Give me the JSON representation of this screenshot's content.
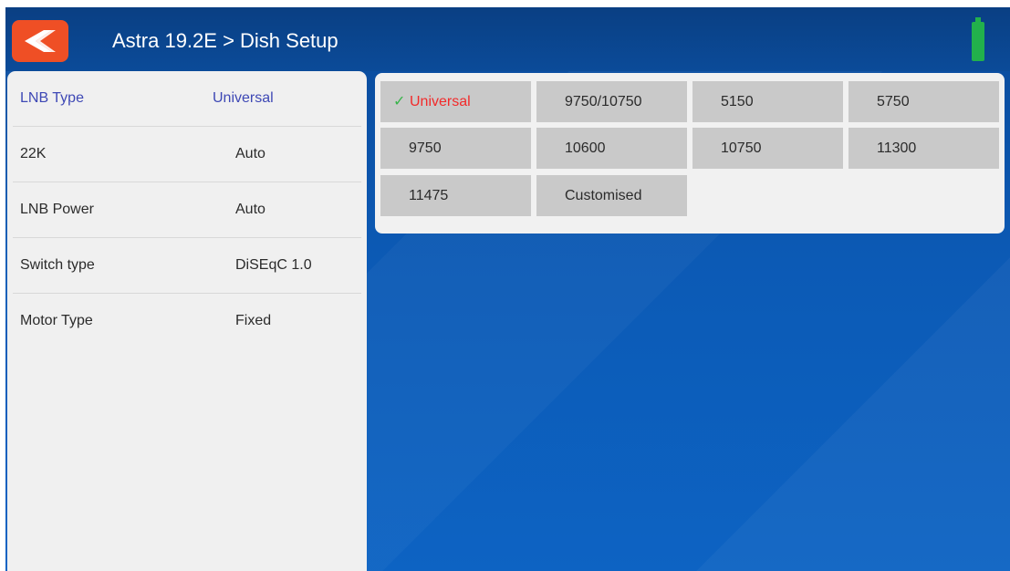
{
  "header": {
    "title": "Astra 19.2E > Dish Setup",
    "back_icon": "back-arrow-icon",
    "battery_icon": "battery-icon",
    "accent": "#ef4f25",
    "battery_color": "#22b14c"
  },
  "settings": [
    {
      "label": "LNB Type",
      "value": "Universal",
      "active": true
    },
    {
      "label": "22K",
      "value": "Auto",
      "active": false
    },
    {
      "label": "LNB Power",
      "value": "Auto",
      "active": false
    },
    {
      "label": "Switch type",
      "value": "DiSEqC 1.0",
      "active": false
    },
    {
      "label": "Motor Type",
      "value": "Fixed",
      "active": false
    }
  ],
  "lnb_options": [
    {
      "label": "Universal",
      "selected": true
    },
    {
      "label": "9750/10750",
      "selected": false
    },
    {
      "label": "5150",
      "selected": false
    },
    {
      "label": "5750",
      "selected": false
    },
    {
      "label": "9750",
      "selected": false
    },
    {
      "label": "10600",
      "selected": false
    },
    {
      "label": "10750",
      "selected": false
    },
    {
      "label": "11300",
      "selected": false
    },
    {
      "label": "11475",
      "selected": false
    },
    {
      "label": "Customised",
      "selected": false
    }
  ],
  "check_icon": "check-icon",
  "colors": {
    "active_text": "#3e48b5",
    "selected_text": "#f22b2b",
    "check": "#38b44a",
    "background": "#0d5ab6"
  }
}
